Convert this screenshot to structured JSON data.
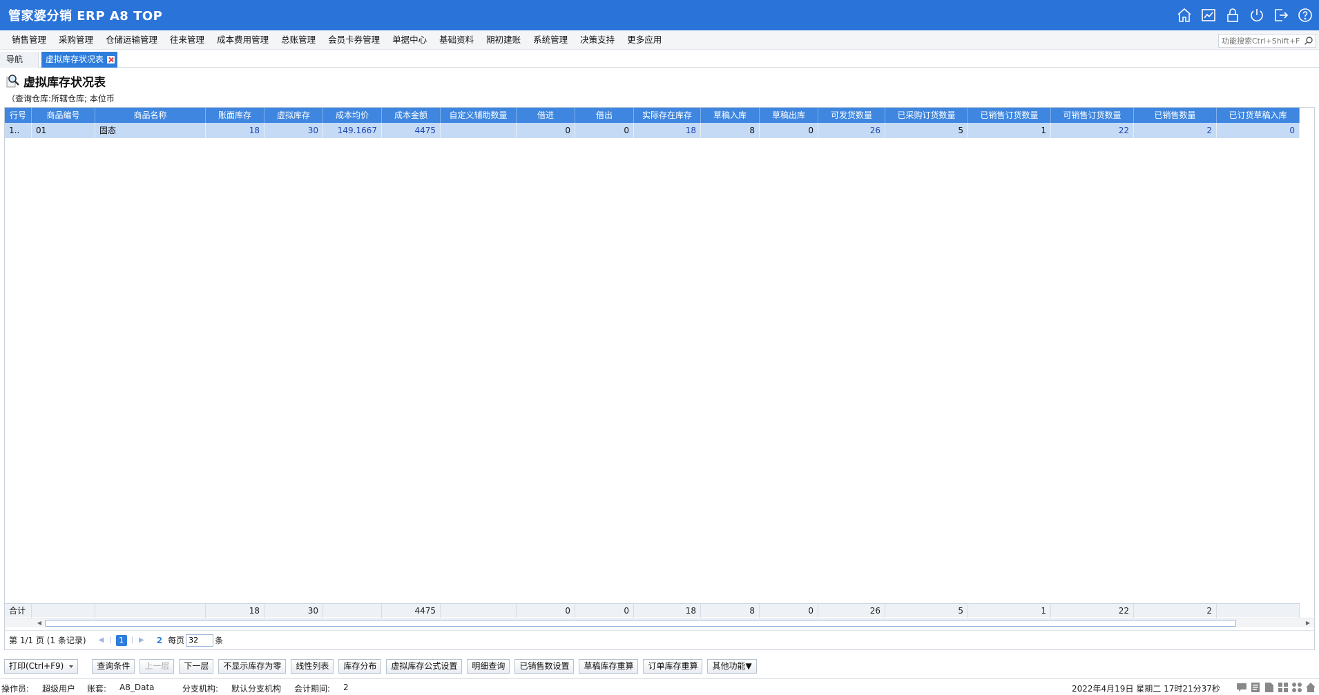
{
  "app": {
    "title": "管家婆分销 ERP A8 TOP"
  },
  "menu": {
    "items": [
      "销售管理",
      "采购管理",
      "仓储运输管理",
      "往来管理",
      "成本费用管理",
      "总账管理",
      "会员卡券管理",
      "单据中心",
      "基础资料",
      "期初建账",
      "系统管理",
      "决策支持",
      "更多应用"
    ],
    "search_placeholder": "功能搜索Ctrl+Shift+F"
  },
  "tabs": {
    "nav": "导航",
    "active": "虚拟库存状况表"
  },
  "report": {
    "title": "虚拟库存状况表",
    "query": "（查询仓库:所辖仓库;  本位币"
  },
  "table": {
    "headers": [
      "行号",
      "商品编号",
      "商品名称",
      "账面库存",
      "虚拟库存",
      "成本均价",
      "成本金额",
      "自定义辅助数量",
      "借进",
      "借出",
      "实际存在库存",
      "草稿入库",
      "草稿出库",
      "可发货数量",
      "已采购订货数量",
      "已销售订货数量",
      "可销售订货数量",
      "已销售数量",
      "已订货草稿入库"
    ],
    "rows": [
      [
        "1..",
        "01",
        "固态",
        "18",
        "30",
        "149.1667",
        "4475",
        "",
        "0",
        "0",
        "18",
        "8",
        "0",
        "26",
        "5",
        "1",
        "22",
        "2",
        "0"
      ]
    ],
    "total_label": "合计",
    "totals": [
      "",
      "",
      "18",
      "30",
      "",
      "4475",
      "",
      "0",
      "0",
      "18",
      "8",
      "0",
      "26",
      "5",
      "1",
      "22",
      "2",
      ""
    ]
  },
  "pager": {
    "page_info": "第  1/1 页  (1 条记录)",
    "current_page": "1",
    "refresh": "2",
    "per_page_label": "每页",
    "per_page": "32",
    "unit": "条"
  },
  "toolbar": {
    "buttons": [
      "打印(Ctrl+F9)",
      "查询条件",
      "上一层",
      "下一层",
      "不显示库存为零",
      "线性列表",
      "库存分布",
      "虚拟库存公式设置",
      "明细查询",
      "已销售数设置",
      "草稿库存重算",
      "订单库存重算",
      "其他功能▼"
    ]
  },
  "status": {
    "operator_label": "操作员:",
    "operator": "超级用户",
    "account_label": "账套:",
    "account": "A8_Data",
    "branch_label": "分支机构:",
    "branch": "默认分支机构",
    "period_label": "会计期间:",
    "period": "2",
    "datetime": "2022年4月19日  星期二  17时21分37秒"
  },
  "colors": {
    "titlebar": "#2a73d8",
    "header": "#3e86df",
    "selected_row": "#c5daf5",
    "accent": "#2e7ddc"
  }
}
